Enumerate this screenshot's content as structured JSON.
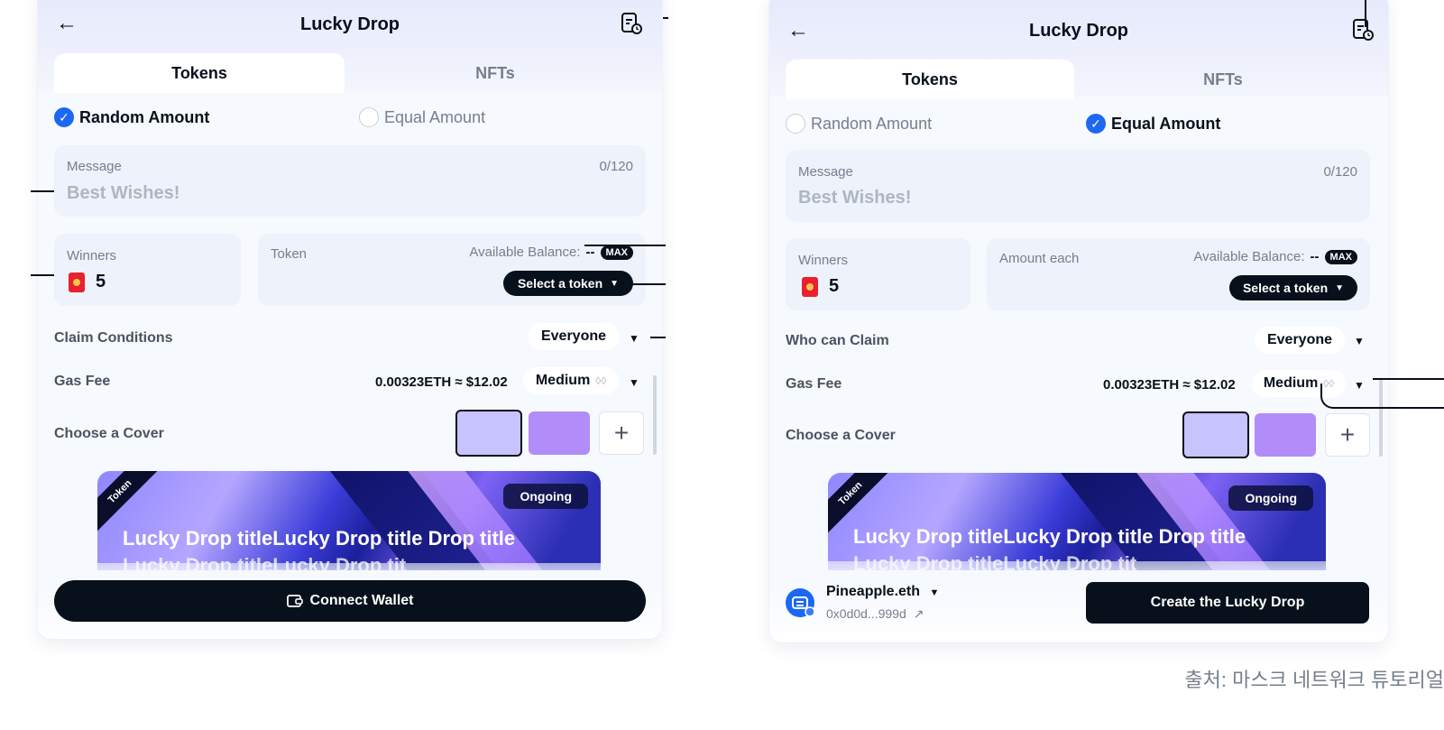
{
  "left": {
    "title": "Lucky Drop",
    "tabs": [
      {
        "label": "Tokens"
      },
      {
        "label": "NFTs"
      }
    ],
    "options": [
      {
        "label": "Random Amount"
      },
      {
        "label": "Equal Amount"
      }
    ],
    "message": {
      "label": "Message",
      "placeholder": "Best Wishes!",
      "count": "0/120"
    },
    "winners": {
      "label": "Winners",
      "value": "5"
    },
    "token": {
      "label": "Token",
      "balance_label": "Available Balance:",
      "balance_value": "--",
      "max": "MAX",
      "select": "Select a token"
    },
    "claim": {
      "label": "Claim Conditions",
      "value": "Everyone"
    },
    "gas": {
      "label": "Gas Fee",
      "value": "0.00323ETH ≈ $12.02",
      "speed": "Medium"
    },
    "cover": {
      "label": "Choose a Cover",
      "add": "+"
    },
    "card": {
      "badge": "Token",
      "status": "Ongoing",
      "title_line1": "Lucky Drop titleLucky Drop title Drop title",
      "title_line2": "Lucky Drop titleLucky Drop tit"
    },
    "footer": {
      "connect": "Connect Wallet"
    }
  },
  "right": {
    "title": "Lucky Drop",
    "tabs": [
      {
        "label": "Tokens"
      },
      {
        "label": "NFTs"
      }
    ],
    "options": [
      {
        "label": "Random Amount"
      },
      {
        "label": "Equal Amount"
      }
    ],
    "message": {
      "label": "Message",
      "placeholder": "Best Wishes!",
      "count": "0/120"
    },
    "winners": {
      "label": "Winners",
      "value": "5"
    },
    "token": {
      "label": "Amount each",
      "balance_label": "Available Balance:",
      "balance_value": "--",
      "max": "MAX",
      "select": "Select a token"
    },
    "claim": {
      "label": "Who can Claim",
      "value": "Everyone"
    },
    "gas": {
      "label": "Gas Fee",
      "value": "0.00323ETH ≈ $12.02",
      "speed": "Medium"
    },
    "cover": {
      "label": "Choose a Cover",
      "add": "+"
    },
    "card": {
      "badge": "Token",
      "status": "Ongoing",
      "title_line1": "Lucky Drop titleLucky Drop title Drop title",
      "title_line2": "Lucky Drop titleLucky Drop tit"
    },
    "footer": {
      "account_name": "Pineapple.eth",
      "account_address": "0x0d0d...999d",
      "create": "Create the Lucky Drop"
    }
  },
  "source": "출처: 마스크 네트워크 튜토리얼",
  "colors": {
    "accent": "#1c68f3",
    "dark": "#07101b",
    "muted": "#767f8d",
    "field_bg": "#edf2fb",
    "panel_bg": "#f6f9fe",
    "cover_a": "#c7c3fc",
    "cover_b": "#b28cf8",
    "red_packet": "#e8202f"
  },
  "icons": {
    "back": "arrow-left-icon",
    "history": "history-document-icon",
    "check": "check-circle-icon",
    "caret": "caret-down-icon",
    "wallet": "wallet-icon",
    "drops": "gas-drops-icon",
    "external": "external-link-icon",
    "red_packet": "red-packet-icon"
  }
}
